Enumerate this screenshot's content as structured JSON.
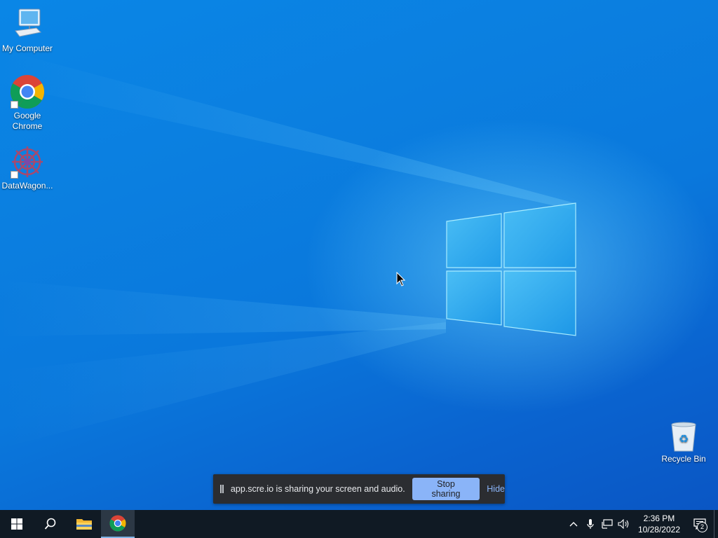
{
  "desktop": {
    "icons": [
      {
        "label": "My Computer",
        "icon": "computer-icon"
      },
      {
        "label": "Google Chrome",
        "icon": "chrome-icon",
        "shortcut": true
      },
      {
        "label": "DataWagon...",
        "icon": "datawagon-icon",
        "shortcut": true
      },
      {
        "label": "Recycle Bin",
        "icon": "recycle-bin-icon"
      }
    ]
  },
  "share_bar": {
    "message": "app.scre.io is sharing your screen and audio.",
    "stop_label": "Stop sharing",
    "hide_label": "Hide"
  },
  "taskbar": {
    "start": "windows-start-icon",
    "search": "search-icon",
    "pinned": [
      {
        "name": "File Explorer",
        "icon": "folder-icon"
      },
      {
        "name": "Google Chrome",
        "icon": "chrome-icon",
        "active": true
      }
    ]
  },
  "tray": {
    "time": "2:36 PM",
    "date": "10/28/2022",
    "notification_count": "2"
  },
  "colors": {
    "taskbar": "#101a24",
    "share_bar": "#2b2d31",
    "stop_button": "#8ab4f8"
  }
}
